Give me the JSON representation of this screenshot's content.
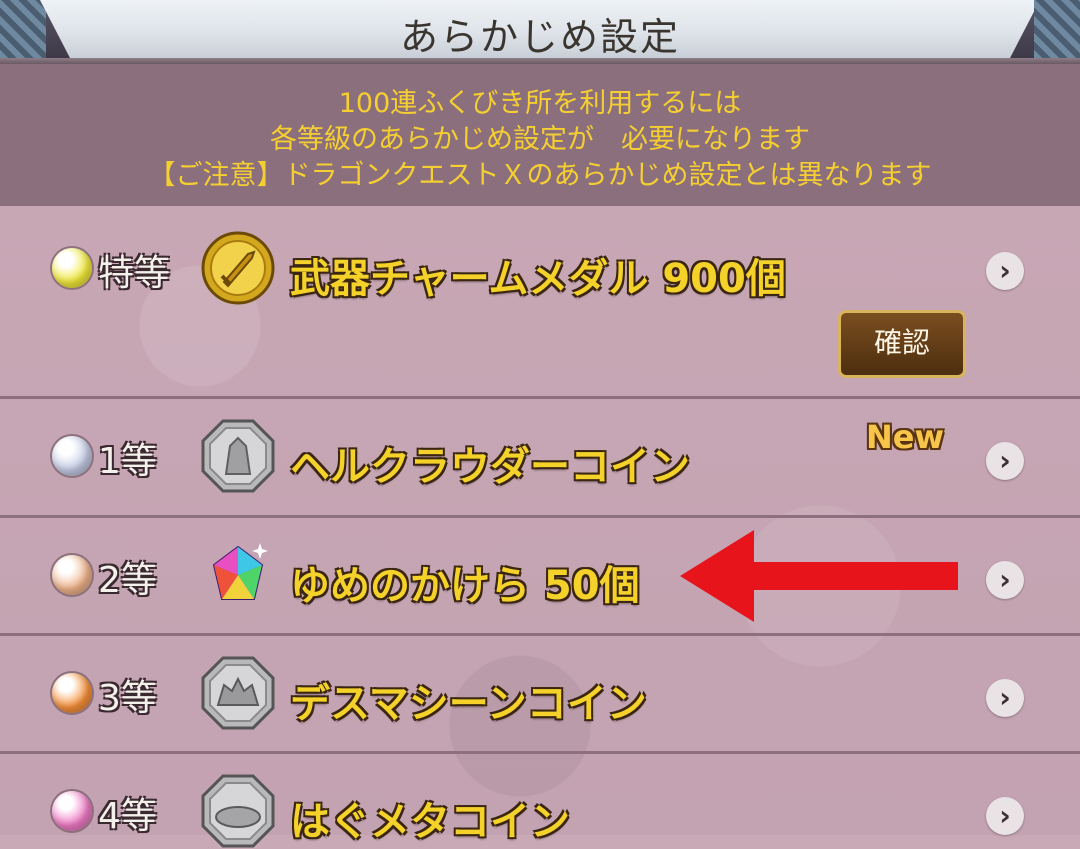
{
  "header": {
    "title": "あらかじめ設定"
  },
  "notice": {
    "lines": [
      "100連ふくびき所を利用するには",
      "各等級のあらかじめ設定が　必要になります",
      "【ご注意】ドラゴンクエストＸのあらかじめ設定とは異なります"
    ]
  },
  "colors": {
    "notice_text": "#f5cf31",
    "item_text": "#f4d22a",
    "arrow": "#e8141c"
  },
  "rows": [
    {
      "rank": "特等",
      "orb_color": "#f2ea3b",
      "icon": "sword-medal-icon",
      "item": "武器チャームメダル  900個",
      "button": "確認"
    },
    {
      "rank": "1等",
      "orb_color": "#c5cde6",
      "icon": "hell-clouder-coin-icon",
      "item": "ヘルクラウダーコイン",
      "badge": "New"
    },
    {
      "rank": "2等",
      "orb_color": "#f0b48c",
      "icon": "rainbow-gem-icon",
      "item": "ゆめのかけら  50個"
    },
    {
      "rank": "3等",
      "orb_color": "#f7913a",
      "icon": "death-machine-coin-icon",
      "item": "デスマシーンコイン"
    },
    {
      "rank": "4等",
      "orb_color": "#f07cc6",
      "icon": "hagu-meta-coin-icon",
      "item": "はぐメタコイン"
    }
  ],
  "chevron": "›"
}
